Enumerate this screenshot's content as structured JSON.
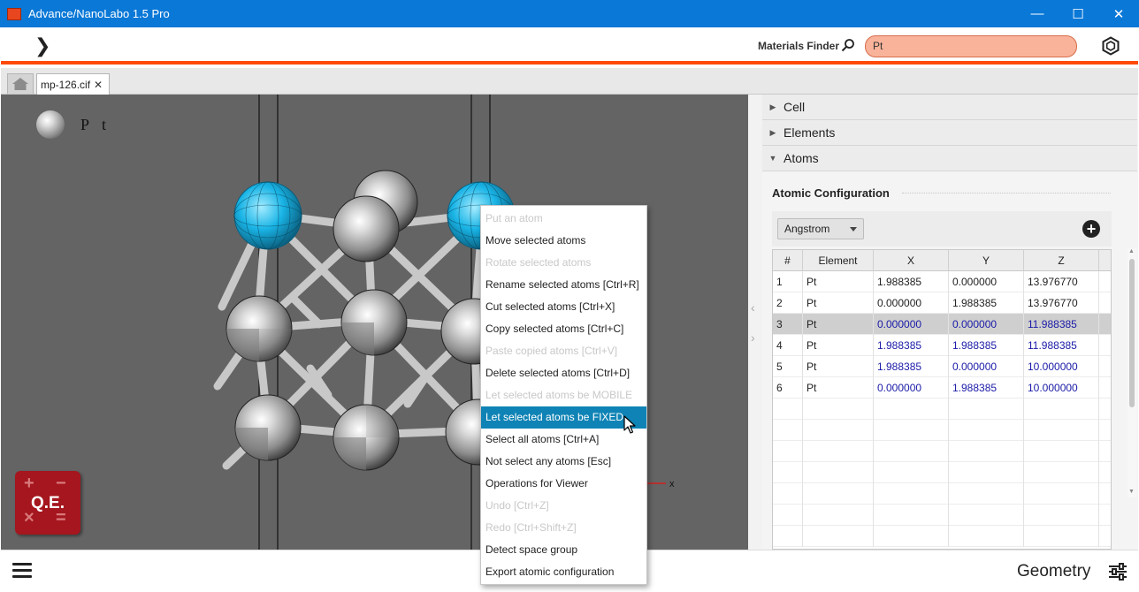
{
  "window": {
    "title": "Advance/NanoLabo 1.5 Pro",
    "controls": {
      "minimize": "—",
      "maximize": "☐",
      "close": "✕"
    }
  },
  "toolbar": {
    "materials_finder_label": "Materials Finder",
    "search_value": "Pt"
  },
  "tabs": {
    "file_tab_label": "mp-126.cif",
    "file_tab_close": "✕"
  },
  "viewer": {
    "legend": {
      "element": "Pt"
    },
    "qe_logo": {
      "text": "Q.E.",
      "symbols": [
        "+",
        "−",
        "×",
        "="
      ]
    },
    "axis_label": "x"
  },
  "panel": {
    "sections": [
      {
        "label": "Cell",
        "expanded": false
      },
      {
        "label": "Elements",
        "expanded": false
      },
      {
        "label": "Atoms",
        "expanded": true
      }
    ],
    "atomic_configuration_title": "Atomic Configuration",
    "units_select": "Angstrom",
    "table": {
      "headers": [
        "#",
        "Element",
        "X",
        "Y",
        "Z"
      ],
      "rows": [
        {
          "n": "1",
          "el": "Pt",
          "x": "1.988385",
          "y": "0.000000",
          "z": "13.976770",
          "fixed": false
        },
        {
          "n": "2",
          "el": "Pt",
          "x": "0.000000",
          "y": "1.988385",
          "z": "13.976770",
          "fixed": false
        },
        {
          "n": "3",
          "el": "Pt",
          "x": "0.000000",
          "y": "0.000000",
          "z": "11.988385",
          "fixed": true
        },
        {
          "n": "4",
          "el": "Pt",
          "x": "1.988385",
          "y": "1.988385",
          "z": "11.988385",
          "fixed": true
        },
        {
          "n": "5",
          "el": "Pt",
          "x": "1.988385",
          "y": "0.000000",
          "z": "10.000000",
          "fixed": true
        },
        {
          "n": "6",
          "el": "Pt",
          "x": "0.000000",
          "y": "1.988385",
          "z": "10.000000",
          "fixed": true
        }
      ]
    }
  },
  "context_menu": {
    "items": [
      {
        "label": "Put an atom",
        "enabled": false
      },
      {
        "label": "Move selected atoms",
        "enabled": true
      },
      {
        "label": "Rotate selected atoms",
        "enabled": false
      },
      {
        "label": "Rename selected atoms [Ctrl+R]",
        "enabled": true
      },
      {
        "label": "Cut selected atoms [Ctrl+X]",
        "enabled": true
      },
      {
        "label": "Copy selected atoms [Ctrl+C]",
        "enabled": true
      },
      {
        "label": "Paste copied atoms [Ctrl+V]",
        "enabled": false
      },
      {
        "label": "Delete selected atoms [Ctrl+D]",
        "enabled": true
      },
      {
        "label": "Let selected atoms be MOBILE",
        "enabled": false
      },
      {
        "label": "Let selected atoms be FIXED",
        "enabled": true,
        "highlighted": true
      },
      {
        "label": "Select all atoms [Ctrl+A]",
        "enabled": true
      },
      {
        "label": "Not select any atoms [Esc]",
        "enabled": true
      },
      {
        "label": "Operations for Viewer",
        "enabled": true
      },
      {
        "label": "Undo [Ctrl+Z]",
        "enabled": false
      },
      {
        "label": "Redo [Ctrl+Shift+Z]",
        "enabled": false
      },
      {
        "label": "Detect space group",
        "enabled": true
      },
      {
        "label": "Export atomic configuration",
        "enabled": true
      }
    ]
  },
  "bottom_bar": {
    "mode_label": "Geometry"
  },
  "colors": {
    "titlebar": "#0a78d7",
    "accent_orange": "#ff4a08",
    "search_fill": "#f9b39a",
    "menu_highlight": "#0f83b5",
    "selected_atoms": "#19b4e6",
    "fixed_coord_text": "#1a1aa8"
  }
}
